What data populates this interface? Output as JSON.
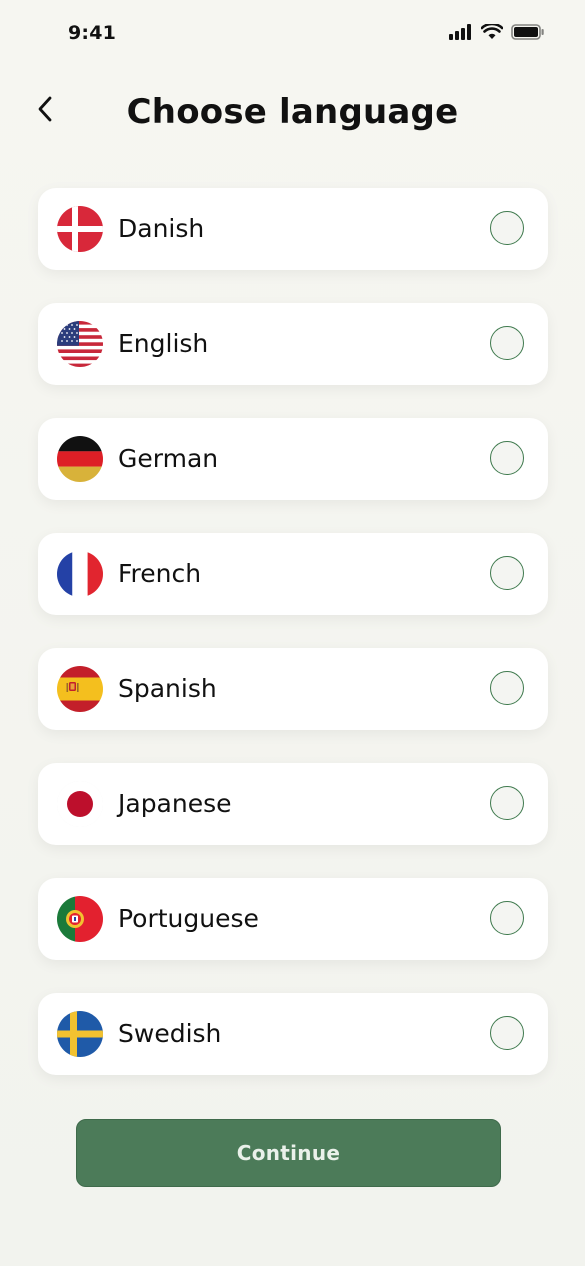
{
  "status_bar": {
    "time": "9:41"
  },
  "header": {
    "title": "Choose language"
  },
  "languages": [
    {
      "label": "Danish",
      "flag": "denmark-flag-icon"
    },
    {
      "label": "English",
      "flag": "usa-flag-icon"
    },
    {
      "label": "German",
      "flag": "germany-flag-icon"
    },
    {
      "label": "French",
      "flag": "france-flag-icon"
    },
    {
      "label": "Spanish",
      "flag": "spain-flag-icon"
    },
    {
      "label": "Japanese",
      "flag": "japan-flag-icon"
    },
    {
      "label": "Portuguese",
      "flag": "portugal-flag-icon"
    },
    {
      "label": "Swedish",
      "flag": "sweden-flag-icon"
    }
  ],
  "actions": {
    "continue_label": "Continue"
  },
  "colors": {
    "accent": "#4c7b59",
    "radio_border": "#3f7a4e",
    "background": "#f4f4ef"
  }
}
